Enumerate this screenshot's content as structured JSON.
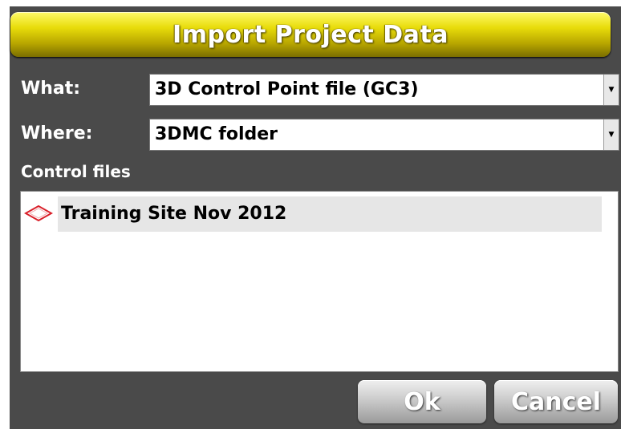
{
  "dialog": {
    "title": "Import Project Data"
  },
  "what": {
    "label": "What:",
    "value": "3D Control Point file (GC3)"
  },
  "where": {
    "label": "Where:",
    "value": "3DMC folder"
  },
  "control_files": {
    "label": "Control files",
    "items": [
      {
        "name": "Training Site Nov 2012",
        "icon": "control-point-diamond-icon"
      }
    ]
  },
  "buttons": {
    "ok": "Ok",
    "cancel": "Cancel"
  },
  "colors": {
    "title_bar": "#e8dc0a",
    "background": "#4a4a4a",
    "icon_accent": "#d9202a"
  }
}
